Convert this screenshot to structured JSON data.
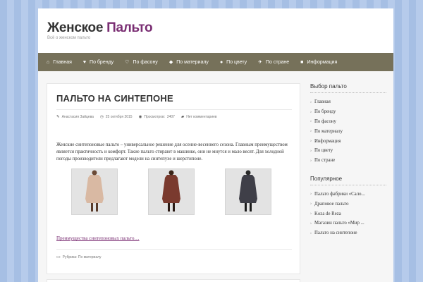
{
  "header": {
    "title_part1": "Женское",
    "title_part2": "Пальто",
    "description": "Всё о женском пальто"
  },
  "nav": {
    "items": [
      {
        "label": "Главная",
        "icon": "home-icon"
      },
      {
        "label": "По бренду",
        "icon": "heart-icon"
      },
      {
        "label": "По фасону",
        "icon": "heart-outline-icon"
      },
      {
        "label": "По материалу",
        "icon": "tag-icon"
      },
      {
        "label": "По цвету",
        "icon": "drop-icon"
      },
      {
        "label": "По стране",
        "icon": "plane-icon"
      },
      {
        "label": "Информация",
        "icon": "book-icon"
      }
    ]
  },
  "post": {
    "title": "ПАЛЬТО НА СИНТЕПОНЕ",
    "author": "Анастасия Зайцева",
    "date": "25 октября 2015",
    "views_label": "Просмотров:",
    "views": "2407",
    "comments": "Нет комментариев",
    "text": "Женские синтепоновые пальто – универсальное решение для осенне-весеннего сезона. Главным преимуществом является практичность и комфорт. Такие пальто стирают в машинке, они не мнутся и мало весят. Для холодной погоды производители предлагают модели на синтепухе и шерстипоне.",
    "read_more": "Преимущества синтепоновых пальто…",
    "category_label": "Рубрика:",
    "category": "По материалу",
    "photos": [
      {
        "color": "#d9b9a3"
      },
      {
        "color": "#7a3a2e"
      },
      {
        "color": "#3f3f48"
      }
    ]
  },
  "sidebar": {
    "widgets": [
      {
        "title": "Выбор пальто",
        "items": [
          "Главная",
          "По бренду",
          "По фасону",
          "По материалу",
          "Информация",
          "По цвету",
          "По стране"
        ]
      },
      {
        "title": "Популярное",
        "items": [
          "Пальто фабрики «Сало...",
          "Драповое пальто",
          "Koza de Reza",
          "Магазин пальто «Мир ...",
          "Пальто на синтепоне"
        ]
      }
    ]
  },
  "colors": {
    "accent": "#7a2e73",
    "nav_bg": "#76715a",
    "page_bg": "#a9c1e6"
  }
}
